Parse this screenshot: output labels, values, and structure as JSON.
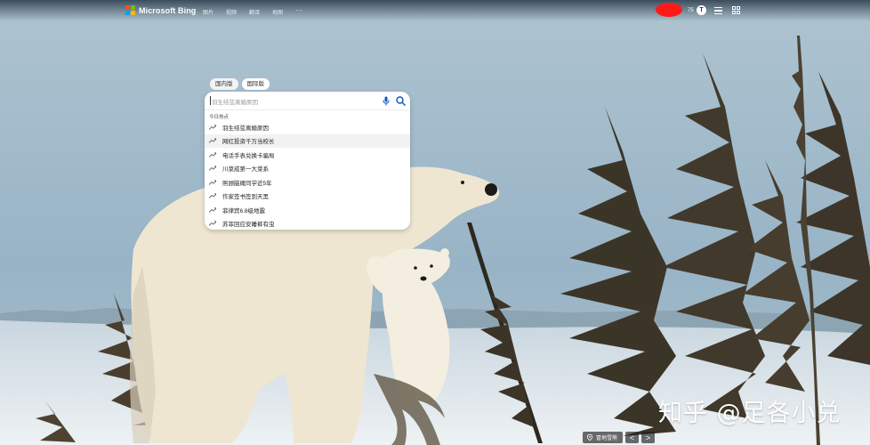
{
  "header": {
    "brand": "Microsoft Bing",
    "nav": [
      "图片",
      "视频",
      "翻译",
      "地图",
      "···"
    ],
    "rewards_points": "75",
    "rewards_letter": "T"
  },
  "search": {
    "tabs": [
      "国内版",
      "国际版"
    ],
    "active_tab": "国内版",
    "placeholder": "羽生结弦离婚原因",
    "section_title": "今日热点",
    "suggestions": [
      "羽生结弦离婚原因",
      "网红投资千万当校长",
      "电话手表兑换卡骗局",
      "川菜成第一大菜系",
      "照顾脑瘫同学近5年",
      "作家签书签到天黑",
      "菲律宾6.8级地震",
      "苏菲回应安睡裤有虫"
    ],
    "highlighted_index": 1
  },
  "footer": {
    "image_info_label": "冒地雪熊",
    "prev": "<",
    "next": ">",
    "watermark": "知乎 @足各小兑"
  },
  "colors": {
    "sky": "#9fb8c8",
    "snow": "#e9eef2",
    "bear": "#efe6d2",
    "tree": "#3b3528",
    "logo_red": "#f25022",
    "logo_green": "#7fba00",
    "logo_blue": "#00a4ef",
    "logo_yellow": "#ffb900",
    "redacted_blob": "#ff1a1a"
  }
}
